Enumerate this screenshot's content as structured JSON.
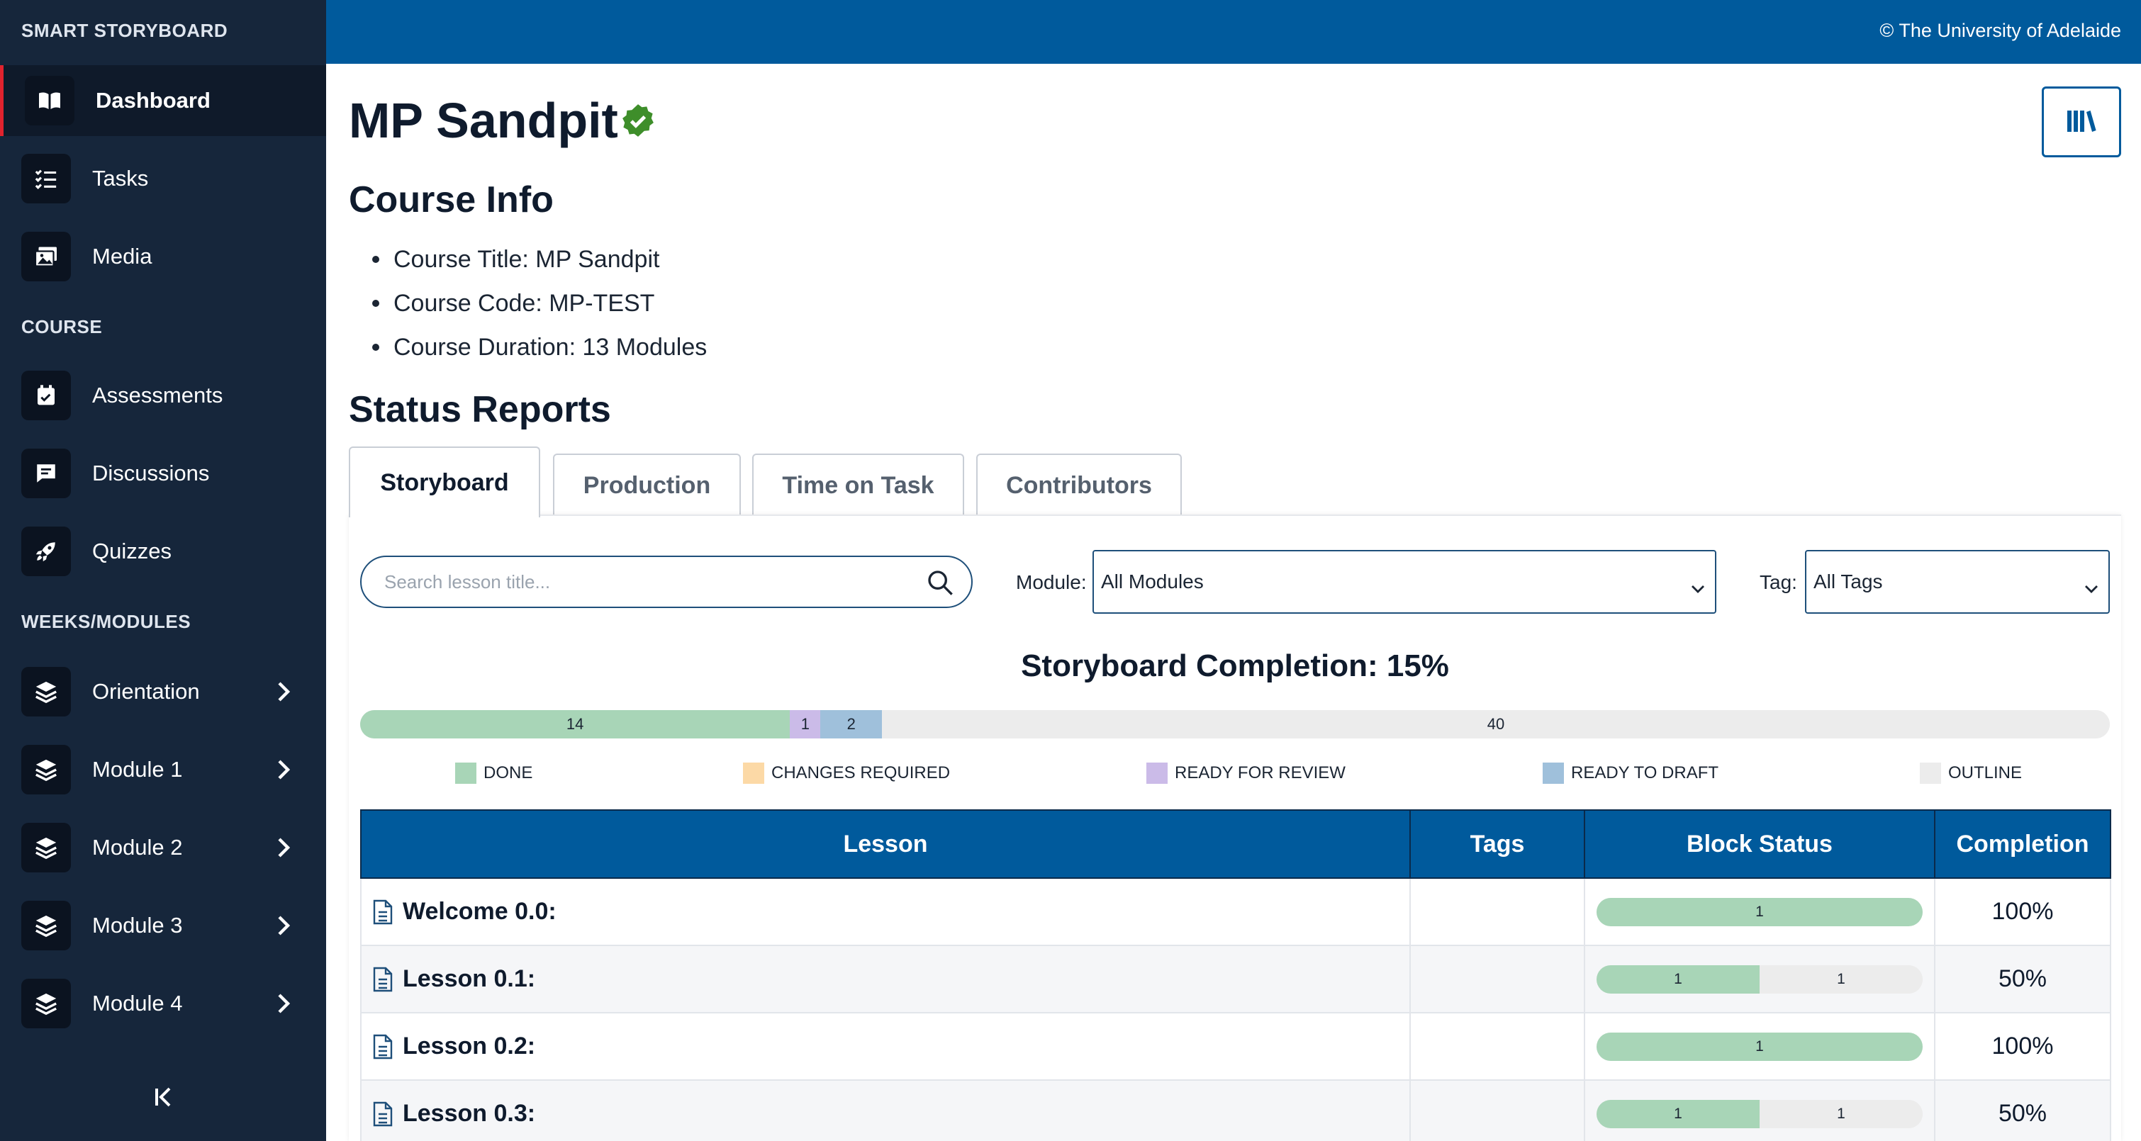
{
  "app": {
    "brand": "SMART STORYBOARD",
    "copyright": "© The University of Adelaide"
  },
  "sidebar": {
    "top_items": [
      {
        "label": "Dashboard",
        "icon": "book-open-icon",
        "active": true
      },
      {
        "label": "Tasks",
        "icon": "task-list-icon"
      },
      {
        "label": "Media",
        "icon": "photo-gallery-icon"
      }
    ],
    "course_label": "COURSE",
    "course_items": [
      {
        "label": "Assessments",
        "icon": "calendar-check-icon"
      },
      {
        "label": "Discussions",
        "icon": "comment-icon"
      },
      {
        "label": "Quizzes",
        "icon": "rocket-icon"
      }
    ],
    "modules_label": "WEEKS/MODULES",
    "module_items": [
      {
        "label": "Orientation",
        "icon": "layers-icon"
      },
      {
        "label": "Module 1",
        "icon": "layers-icon"
      },
      {
        "label": "Module 2",
        "icon": "layers-icon"
      },
      {
        "label": "Module 3",
        "icon": "layers-icon"
      },
      {
        "label": "Module 4",
        "icon": "layers-icon"
      }
    ]
  },
  "page": {
    "title": "MP Sandpit",
    "course_info_heading": "Course Info",
    "course_info": [
      "Course Title:  MP Sandpit",
      "Course Code:  MP-TEST",
      "Course Duration:  13 Modules"
    ],
    "status_heading": "Status Reports"
  },
  "tabs": [
    {
      "label": "Storyboard",
      "active": true
    },
    {
      "label": "Production"
    },
    {
      "label": "Time on Task"
    },
    {
      "label": "Contributors"
    }
  ],
  "filters": {
    "search_placeholder": "Search lesson title...",
    "module_label": "Module:",
    "module_value": "All Modules",
    "tag_label": "Tag:",
    "tag_value": "All Tags"
  },
  "completion": {
    "title": "Storyboard Completion: 15%",
    "segments": [
      {
        "status": "DONE",
        "count": 14,
        "color": "#a8d5b7"
      },
      {
        "status": "READY FOR REVIEW",
        "count": 1,
        "color": "#cbbbe8"
      },
      {
        "status": "READY TO DRAFT",
        "count": 2,
        "color": "#9fc0db"
      },
      {
        "status": "OUTLINE",
        "count": 40,
        "color": "#ececec"
      }
    ],
    "segment_labels": [
      "14",
      "1",
      "2",
      "40"
    ],
    "legend": [
      {
        "label": "DONE",
        "color": "#a8d5b7"
      },
      {
        "label": "CHANGES REQUIRED",
        "color": "#fcd9a6"
      },
      {
        "label": "READY FOR REVIEW",
        "color": "#cbbbe8"
      },
      {
        "label": "READY TO DRAFT",
        "color": "#9fc0db"
      },
      {
        "label": "OUTLINE",
        "color": "#ececec"
      }
    ]
  },
  "table": {
    "headers": [
      "Lesson",
      "Tags",
      "Block Status",
      "Completion"
    ],
    "rows": [
      {
        "lesson": "Welcome 0.0:",
        "tags": "",
        "blocks": [
          {
            "count": 1,
            "color": "#a8d5b7"
          }
        ],
        "block_labels": [
          "1"
        ],
        "completion": "100%"
      },
      {
        "lesson": "Lesson 0.1:",
        "tags": "",
        "blocks": [
          {
            "count": 1,
            "color": "#a8d5b7"
          },
          {
            "count": 1,
            "color": "#ececec"
          }
        ],
        "block_labels": [
          "1",
          "1"
        ],
        "completion": "50%"
      },
      {
        "lesson": "Lesson 0.2:",
        "tags": "",
        "blocks": [
          {
            "count": 1,
            "color": "#a8d5b7"
          }
        ],
        "block_labels": [
          "1"
        ],
        "completion": "100%"
      },
      {
        "lesson": "Lesson 0.3:",
        "tags": "",
        "blocks": [
          {
            "count": 1,
            "color": "#a8d5b7"
          },
          {
            "count": 1,
            "color": "#ececec"
          }
        ],
        "block_labels": [
          "1",
          "1"
        ],
        "completion": "50%"
      }
    ]
  }
}
